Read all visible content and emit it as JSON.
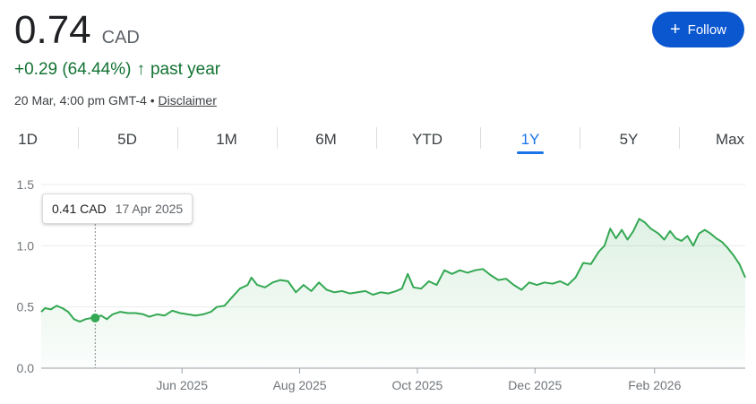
{
  "quote": {
    "price": "0.74",
    "currency": "CAD",
    "change": "+0.29 (64.44%)",
    "change_arrow": "↑",
    "change_period": "past year",
    "timestamp": "20 Mar, 4:00 pm GMT-4",
    "separator": "•",
    "disclaimer_label": "Disclaimer"
  },
  "follow_button": {
    "icon": "plus-icon",
    "label": "Follow"
  },
  "range_tabs": [
    {
      "label": "1D"
    },
    {
      "label": "5D"
    },
    {
      "label": "1M"
    },
    {
      "label": "6M"
    },
    {
      "label": "YTD"
    },
    {
      "label": "1Y",
      "active": true
    },
    {
      "label": "5Y"
    },
    {
      "label": "Max"
    }
  ],
  "tooltip": {
    "price": "0.41 CAD",
    "date": "17 Apr 2025"
  },
  "colors": {
    "accent": "#1a73e8",
    "button": "#0b57d0",
    "positive": "#137333",
    "line": "#34a853"
  },
  "chart_data": {
    "type": "area",
    "y_ticks": [
      "1.5",
      "1.0",
      "0.5",
      "0.0"
    ],
    "ylim": [
      0,
      1.5
    ],
    "x_labels": [
      "Jun 2025",
      "Aug 2025",
      "Oct 2025",
      "Dec 2025",
      "Feb 2026"
    ],
    "x_label_positions": [
      "2025-06-01",
      "2025-08-01",
      "2025-10-01",
      "2025-12-01",
      "2026-02-01"
    ],
    "xlim": [
      "2025-03-20",
      "2026-03-20"
    ],
    "grid": true,
    "hover_point": {
      "x": "2025-04-17",
      "y": 0.41
    },
    "series": [
      {
        "points": [
          [
            "2025-03-20",
            0.46
          ],
          [
            "2025-03-22",
            0.49
          ],
          [
            "2025-03-25",
            0.48
          ],
          [
            "2025-03-28",
            0.51
          ],
          [
            "2025-03-31",
            0.49
          ],
          [
            "2025-04-03",
            0.46
          ],
          [
            "2025-04-06",
            0.4
          ],
          [
            "2025-04-09",
            0.38
          ],
          [
            "2025-04-12",
            0.4
          ],
          [
            "2025-04-15",
            0.41
          ],
          [
            "2025-04-17",
            0.41
          ],
          [
            "2025-04-20",
            0.43
          ],
          [
            "2025-04-23",
            0.4
          ],
          [
            "2025-04-26",
            0.44
          ],
          [
            "2025-04-30",
            0.46
          ],
          [
            "2025-05-04",
            0.45
          ],
          [
            "2025-05-08",
            0.45
          ],
          [
            "2025-05-12",
            0.44
          ],
          [
            "2025-05-15",
            0.42
          ],
          [
            "2025-05-19",
            0.44
          ],
          [
            "2025-05-23",
            0.43
          ],
          [
            "2025-05-27",
            0.47
          ],
          [
            "2025-05-31",
            0.45
          ],
          [
            "2025-06-04",
            0.44
          ],
          [
            "2025-06-08",
            0.43
          ],
          [
            "2025-06-12",
            0.44
          ],
          [
            "2025-06-16",
            0.46
          ],
          [
            "2025-06-19",
            0.5
          ],
          [
            "2025-06-23",
            0.51
          ],
          [
            "2025-06-27",
            0.58
          ],
          [
            "2025-07-01",
            0.65
          ],
          [
            "2025-07-05",
            0.68
          ],
          [
            "2025-07-07",
            0.74
          ],
          [
            "2025-07-10",
            0.68
          ],
          [
            "2025-07-14",
            0.66
          ],
          [
            "2025-07-18",
            0.7
          ],
          [
            "2025-07-22",
            0.72
          ],
          [
            "2025-07-26",
            0.71
          ],
          [
            "2025-07-30",
            0.62
          ],
          [
            "2025-08-03",
            0.68
          ],
          [
            "2025-08-07",
            0.63
          ],
          [
            "2025-08-11",
            0.7
          ],
          [
            "2025-08-15",
            0.64
          ],
          [
            "2025-08-19",
            0.62
          ],
          [
            "2025-08-23",
            0.63
          ],
          [
            "2025-08-27",
            0.61
          ],
          [
            "2025-08-31",
            0.62
          ],
          [
            "2025-09-04",
            0.63
          ],
          [
            "2025-09-08",
            0.6
          ],
          [
            "2025-09-12",
            0.62
          ],
          [
            "2025-09-16",
            0.61
          ],
          [
            "2025-09-20",
            0.63
          ],
          [
            "2025-09-23",
            0.65
          ],
          [
            "2025-09-26",
            0.77
          ],
          [
            "2025-09-29",
            0.66
          ],
          [
            "2025-10-03",
            0.65
          ],
          [
            "2025-10-07",
            0.71
          ],
          [
            "2025-10-11",
            0.68
          ],
          [
            "2025-10-15",
            0.8
          ],
          [
            "2025-10-19",
            0.77
          ],
          [
            "2025-10-23",
            0.8
          ],
          [
            "2025-10-27",
            0.78
          ],
          [
            "2025-10-31",
            0.8
          ],
          [
            "2025-11-04",
            0.81
          ],
          [
            "2025-11-08",
            0.76
          ],
          [
            "2025-11-12",
            0.72
          ],
          [
            "2025-11-16",
            0.73
          ],
          [
            "2025-11-20",
            0.68
          ],
          [
            "2025-11-24",
            0.64
          ],
          [
            "2025-11-28",
            0.7
          ],
          [
            "2025-12-02",
            0.68
          ],
          [
            "2025-12-06",
            0.7
          ],
          [
            "2025-12-10",
            0.69
          ],
          [
            "2025-12-14",
            0.71
          ],
          [
            "2025-12-18",
            0.68
          ],
          [
            "2025-12-22",
            0.74
          ],
          [
            "2025-12-26",
            0.86
          ],
          [
            "2025-12-30",
            0.85
          ],
          [
            "2026-01-03",
            0.95
          ],
          [
            "2026-01-06",
            1.0
          ],
          [
            "2026-01-09",
            1.14
          ],
          [
            "2026-01-12",
            1.06
          ],
          [
            "2026-01-15",
            1.13
          ],
          [
            "2026-01-18",
            1.05
          ],
          [
            "2026-01-21",
            1.12
          ],
          [
            "2026-01-24",
            1.22
          ],
          [
            "2026-01-27",
            1.19
          ],
          [
            "2026-01-30",
            1.14
          ],
          [
            "2026-02-03",
            1.1
          ],
          [
            "2026-02-06",
            1.05
          ],
          [
            "2026-02-09",
            1.12
          ],
          [
            "2026-02-12",
            1.06
          ],
          [
            "2026-02-15",
            1.04
          ],
          [
            "2026-02-18",
            1.08
          ],
          [
            "2026-02-21",
            1.0
          ],
          [
            "2026-02-24",
            1.1
          ],
          [
            "2026-02-27",
            1.13
          ],
          [
            "2026-03-02",
            1.1
          ],
          [
            "2026-03-05",
            1.06
          ],
          [
            "2026-03-08",
            1.03
          ],
          [
            "2026-03-11",
            0.98
          ],
          [
            "2026-03-14",
            0.92
          ],
          [
            "2026-03-17",
            0.85
          ],
          [
            "2026-03-20",
            0.74
          ]
        ]
      }
    ]
  }
}
